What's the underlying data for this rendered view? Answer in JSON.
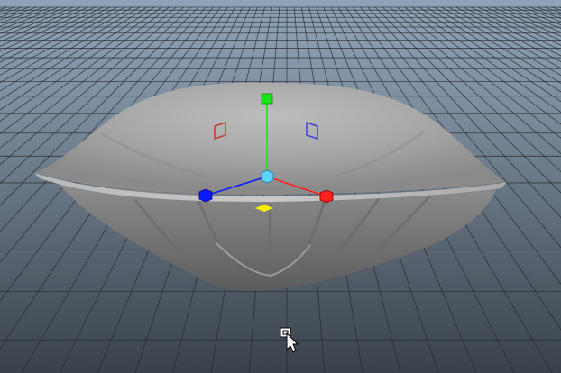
{
  "viewport": {
    "background_top": "#90a3b6",
    "background_bottom": "#3a424b",
    "grid_color": "#1e2329",
    "object": "pillow-mesh",
    "object_color": "#9b9b9b"
  },
  "manipulator": {
    "type": "move-tool",
    "x_axis_color": "#ff2020",
    "y_axis_color": "#19e619",
    "z_axis_color": "#0d1aff",
    "center_color": "#5bd2ff",
    "plane_xy_color": "#d03535",
    "plane_yz_color": "#4040d0",
    "plane_xz_color": "#ffee00"
  },
  "cursor": {
    "icon": "move-cursor-with-box-icon"
  }
}
